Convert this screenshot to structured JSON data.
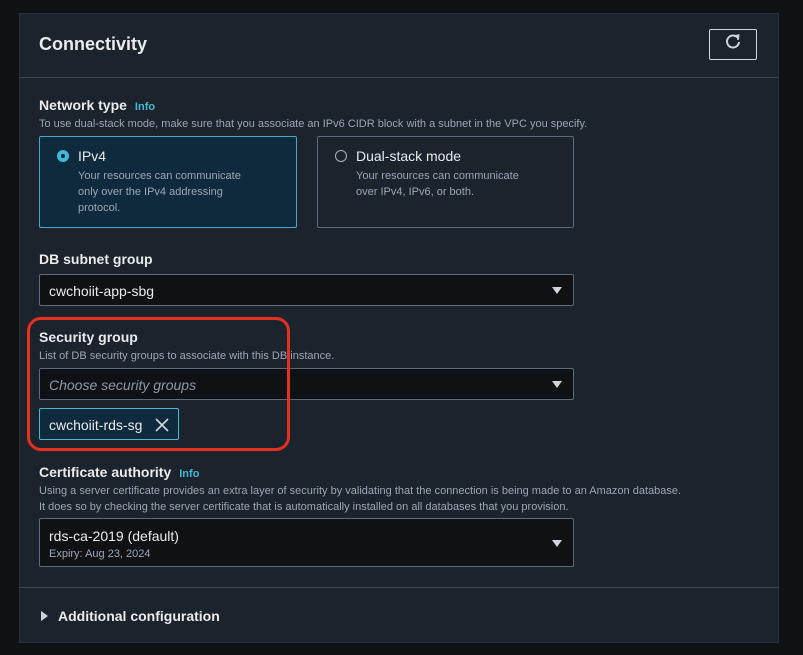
{
  "panel": {
    "title": "Connectivity"
  },
  "network_type": {
    "label": "Network type",
    "info": "Info",
    "description": "To use dual-stack mode, make sure that you associate an IPv6 CIDR block with a subnet in the VPC you specify.",
    "options": [
      {
        "title": "IPv4",
        "desc_lines": [
          "Your resources can communicate",
          "only over the IPv4 addressing",
          "protocol."
        ],
        "selected": true
      },
      {
        "title": "Dual-stack mode",
        "desc_lines": [
          "Your resources can communicate",
          "over IPv4, IPv6, or both."
        ],
        "selected": false
      }
    ]
  },
  "db_subnet_group": {
    "label": "DB subnet group",
    "value": "cwchoiit-app-sbg"
  },
  "security_group": {
    "label": "Security group",
    "description": "List of DB security groups to associate with this DB instance.",
    "placeholder": "Choose security groups",
    "selected_tokens": [
      "cwchoiit-rds-sg"
    ]
  },
  "certificate_authority": {
    "label": "Certificate authority",
    "info": "Info",
    "description_lines": [
      "Using a server certificate provides an extra layer of security by validating that the connection is being made to an Amazon database.",
      "It does so by checking the server certificate that is automatically installed on all databases that you provision."
    ],
    "value": "rds-ca-2019 (default)",
    "sub_value": "Expiry: Aug 23, 2024"
  },
  "additional_configuration": {
    "label": "Additional configuration"
  },
  "colors": {
    "accent": "#44b9d6",
    "highlight": "#e5301f",
    "panel_bg": "#1b232d"
  }
}
